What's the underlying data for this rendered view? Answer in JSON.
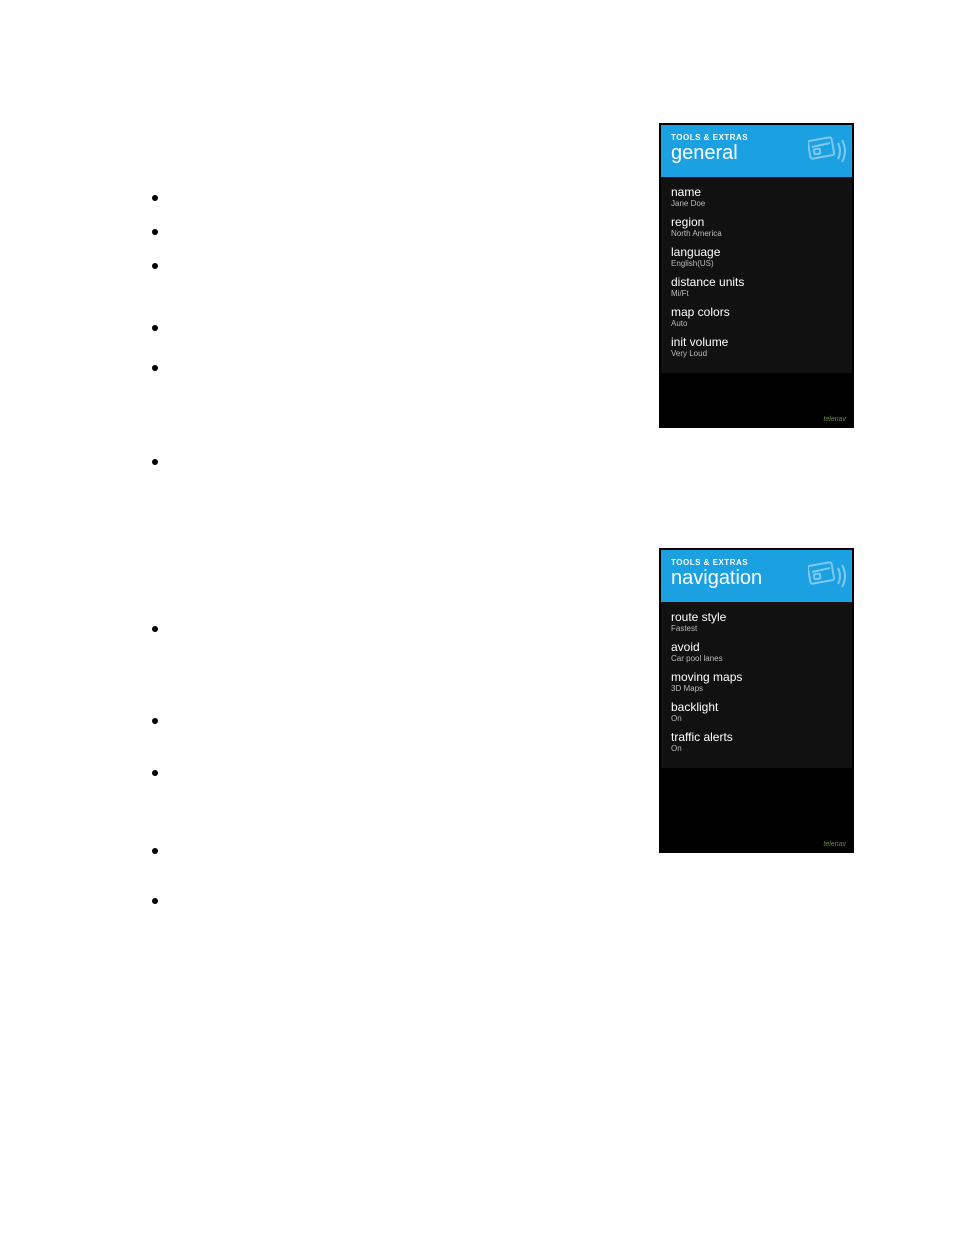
{
  "bullets_group1_tops": [
    0,
    34,
    68,
    130,
    170,
    264
  ],
  "bullets_group2_tops": [
    431,
    523,
    575,
    653,
    703
  ],
  "phones": {
    "general": {
      "sub": "TOOLS & EXTRAS",
      "title": "general",
      "footer": "telenav",
      "items": [
        {
          "label": "name",
          "value": "Jane Doe"
        },
        {
          "label": "region",
          "value": "North America"
        },
        {
          "label": "language",
          "value": "English(US)"
        },
        {
          "label": "distance units",
          "value": "Mi/Ft"
        },
        {
          "label": "map colors",
          "value": "Auto"
        },
        {
          "label": "init volume",
          "value": "Very Loud"
        }
      ]
    },
    "navigation": {
      "sub": "TOOLS & EXTRAS",
      "title": "navigation",
      "footer": "telenav",
      "items": [
        {
          "label": "route style",
          "value": "Fastest"
        },
        {
          "label": "avoid",
          "value": "Car pool lanes"
        },
        {
          "label": "moving maps",
          "value": "3D Maps"
        },
        {
          "label": "backlight",
          "value": "On"
        },
        {
          "label": "traffic alerts",
          "value": "On"
        }
      ]
    }
  }
}
